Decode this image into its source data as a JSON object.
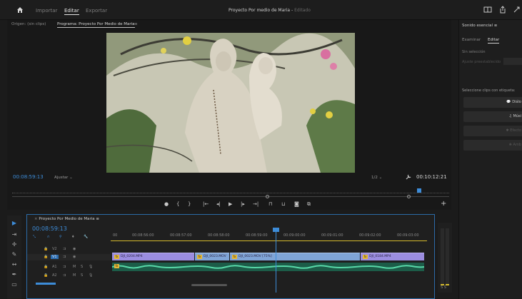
{
  "header": {
    "tabs": [
      {
        "label": "Importar"
      },
      {
        "label": "Editar"
      },
      {
        "label": "Exportar"
      }
    ],
    "project_title": "Proyecto Por medio de Maria",
    "edit_status": "Editado"
  },
  "source_monitor": {
    "tab_label": "Origen: (sin clips)"
  },
  "program_monitor": {
    "tab_label": "Programa: Proyecto Por Medio de Maria",
    "timecode": "00:08:59:13",
    "fit_label": "Ajustar",
    "resolution_label": "1/2",
    "duration": "00:10:12:21"
  },
  "essential_sound": {
    "title": "Sonido esencial",
    "tabs": [
      {
        "label": "Examinar"
      },
      {
        "label": "Editar"
      }
    ],
    "no_selection": "Sin selección",
    "preset_label": "Ajuste preestablecido",
    "instruction": "Seleccione clips con etiqueta:",
    "buttons": [
      {
        "label": "Diálo"
      },
      {
        "label": "Músi"
      },
      {
        "label": "Efecto"
      },
      {
        "label": "Amb"
      }
    ]
  },
  "timeline": {
    "tab_label": "Proyecto Por Medio de Maria",
    "timecode": "00:08:59:13",
    "ruler_labels": [
      "00:08:56:00",
      "00:08:57:00",
      "00:08:58:00",
      "00:08:59:00",
      "00:09:00:00",
      "00:09:01:00",
      "00:09:02:00",
      "00:09:03:00"
    ],
    "tracks": [
      {
        "name": "V2"
      },
      {
        "name": "V1"
      },
      {
        "name": "A1"
      },
      {
        "name": "A2"
      }
    ],
    "clips": [
      {
        "name": "DJI_0204.MP4"
      },
      {
        "name": "DJI_0023.MOV"
      },
      {
        "name": "DJI_0023.MOV [75%]"
      },
      {
        "name": "DJI_0184.MP4"
      }
    ]
  },
  "meters": {
    "label": "S S"
  },
  "colors": {
    "accent": "#3d8cd8",
    "video_clip": "#9b8de0",
    "audio_clip": "#1c5c48",
    "fx_badge": "#e2b63a"
  }
}
